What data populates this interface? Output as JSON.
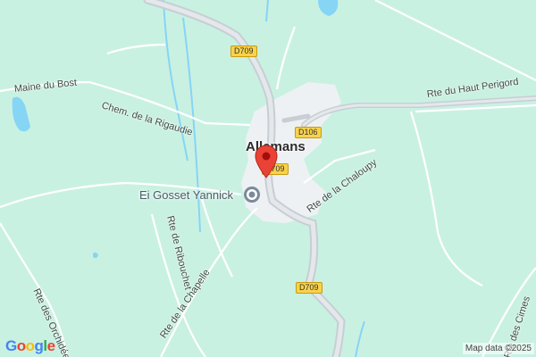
{
  "map": {
    "town": "Allemans",
    "roads": {
      "d709_top": "D709",
      "d709_center": "D709",
      "d709_bottom": "D709",
      "d106": "D106",
      "rte_haut_perigord": "Rte du Haut Perigord",
      "chem_rigaudie": "Chem. de la Rigaudie",
      "maine_du_bost": "Maine du Bost",
      "rte_chaloupy": "Rte de la Chaloupy",
      "rte_ribouchet": "Rte de Ribouchet",
      "rte_chapelle": "Rte de la Chapelle",
      "rte_orchidees": "Rte des Orchidées",
      "rte_cimes": "Rte des Cimes"
    },
    "poi": {
      "name": "Ei Gosset Yannick",
      "icon": "place-icon"
    },
    "marker": {
      "icon": "map-pin-icon",
      "color": "#ea4335"
    },
    "colors": {
      "land": "#c9f1e2",
      "water": "#86d5f5",
      "built_up": "#eef1f3",
      "road": "#c7ced4",
      "road_minor": "#ffffff"
    }
  },
  "branding": {
    "logo": {
      "G1": "G",
      "o1": "o",
      "o2": "o",
      "g": "g",
      "l": "l",
      "e": "e"
    }
  },
  "attribution": "Map data ©2025"
}
